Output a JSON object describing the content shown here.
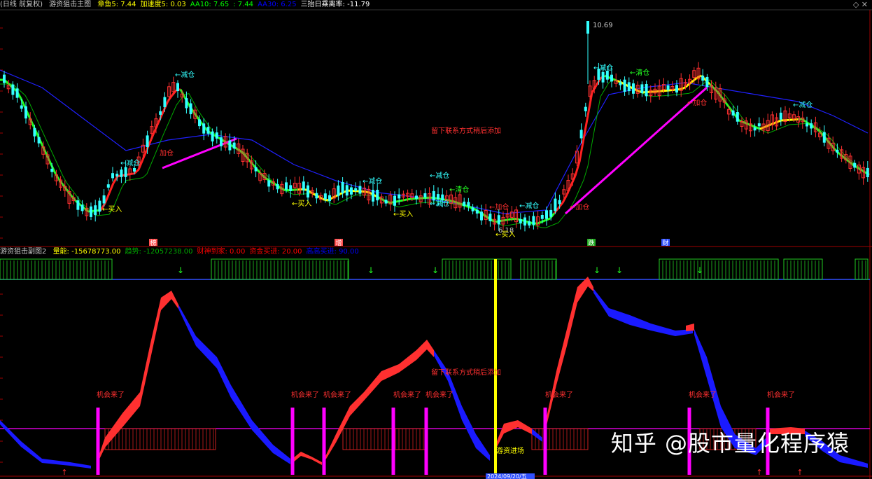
{
  "header": {
    "period": "(日线 前复权)",
    "indicator_name": "游资狙击主图",
    "items": [
      {
        "label": "章鱼5:",
        "value": "7.44",
        "color": "#ffff00"
      },
      {
        "label": "加速度5:",
        "value": "0.03",
        "color": "#ffff00"
      },
      {
        "label": "AA10:",
        "value": "7.65",
        "color": "#00ff00"
      },
      {
        "label": ":",
        "value": "7.44",
        "color": "#00ff00"
      },
      {
        "label": "AA30:",
        "value": "6.25",
        "color": "#0000ff"
      },
      {
        "label": "三抬日乘离率:",
        "value": "-11.79",
        "color": "#ffffff"
      }
    ],
    "window_icons": [
      "◇",
      "✕"
    ]
  },
  "sub_header": {
    "indicator_name": "游资狙击副图2",
    "items": [
      {
        "label": "量能:",
        "value": "-15678773.00",
        "color": "#ffff00"
      },
      {
        "label": "趋势:",
        "value": "-12057238.00",
        "color": "#00aa00"
      },
      {
        "label": "财神到家:",
        "value": "0.00",
        "color": "#ff0000"
      },
      {
        "label": "资金买进:",
        "value": "20.00",
        "color": "#ff0000"
      },
      {
        "label": "高高买进:",
        "value": "90.00",
        "color": "#0000ff"
      }
    ]
  },
  "colors": {
    "background": "#000000",
    "candle_up": "#ff3030",
    "candle_down": "#33ffff",
    "ma_red": "#ff2020",
    "ma_green": "#22ff22",
    "ma_thin_green": "#00aa00",
    "ma_blue": "#2020ff",
    "magenta": "#ff00ff",
    "yellow": "#ffff00",
    "area_red": "#ff3030",
    "area_blue": "#1a1aff"
  },
  "main_annotations": [
    {
      "text": "←减仓",
      "color": "#33ffff"
    },
    {
      "text": "加仓",
      "color": "#ff3030"
    },
    {
      "text": "←减仓",
      "color": "#33ffff"
    },
    {
      "text": "←买入",
      "color": "#ffff00"
    },
    {
      "text": "←减仓",
      "color": "#33ffff"
    },
    {
      "text": "←买入",
      "color": "#ffff00"
    },
    {
      "text": "←减仓",
      "color": "#33ffff"
    },
    {
      "text": "←买入",
      "color": "#ffff00"
    },
    {
      "text": "←减仓",
      "color": "#33ffff"
    },
    {
      "text": "←清仓",
      "color": "#22ff22"
    },
    {
      "text": "←加仓",
      "color": "#ff3030"
    },
    {
      "text": "←减仓",
      "color": "#33ffff"
    },
    {
      "text": "6.18",
      "color": "#c8c8c8"
    },
    {
      "text": "←买入",
      "color": "#ffff00"
    },
    {
      "text": "←加仓",
      "color": "#ff3030"
    },
    {
      "text": "10.69",
      "color": "#c8c8c8"
    },
    {
      "text": "←减仓",
      "color": "#33ffff"
    },
    {
      "text": "←清仓",
      "color": "#22ff22"
    },
    {
      "text": "←加仓",
      "color": "#ff3030"
    },
    {
      "text": "←减仓",
      "color": "#33ffff"
    },
    {
      "text": "留下联系方式稍后添加",
      "color": "#ff3030"
    }
  ],
  "main_markers": [
    {
      "text": "榜",
      "bg": "#ff5050"
    },
    {
      "text": "增",
      "bg": "#ff5050"
    },
    {
      "text": "跌",
      "bg": "#22aa22"
    },
    {
      "text": "财",
      "bg": "#3050ff"
    }
  ],
  "sub_annotations": [
    {
      "text": "机会来了"
    },
    {
      "text": "机会来了"
    },
    {
      "text": "机会来了"
    },
    {
      "text": "机会来了"
    },
    {
      "text": "机会来了"
    },
    {
      "text": "机会来了"
    },
    {
      "text": "机会来了"
    },
    {
      "text": "机会来了"
    }
  ],
  "sub_texts": {
    "note": "留下联系方式稍后添加",
    "entry": "游资进场",
    "date_label": "2024/09/20/五"
  },
  "watermark": "知乎 @股市量化程序猿",
  "chart_data": [
    {
      "type": "candlestick",
      "title": "游资狙击主图",
      "price_high": 10.69,
      "price_low": 6.18,
      "series": [
        {
          "name": "章鱼5",
          "color": "#ffff00"
        },
        {
          "name": "AA10",
          "color": "#00ff00"
        },
        {
          "name": "AA30",
          "color": "#0000ff"
        }
      ]
    },
    {
      "type": "area",
      "title": "游资狙击副图2",
      "series": [
        {
          "name": "量能",
          "value": -15678773.0
        },
        {
          "name": "趋势",
          "value": -12057238.0
        },
        {
          "name": "财神到家",
          "value": 0.0
        },
        {
          "name": "资金买进",
          "value": 20.0
        },
        {
          "name": "高高买进",
          "value": 90.0
        }
      ]
    }
  ]
}
